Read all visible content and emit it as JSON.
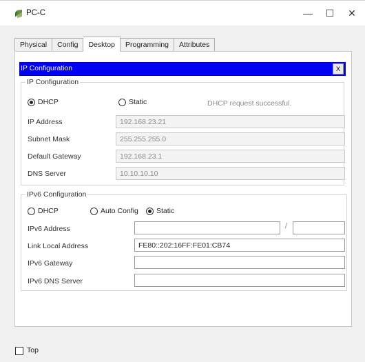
{
  "window": {
    "title": "PC-C",
    "minimize": "—",
    "maximize": "☐",
    "close": "✕"
  },
  "tabs": [
    {
      "label": "Physical",
      "active": false
    },
    {
      "label": "Config",
      "active": false
    },
    {
      "label": "Desktop",
      "active": true
    },
    {
      "label": "Programming",
      "active": false
    },
    {
      "label": "Attributes",
      "active": false
    }
  ],
  "dialog": {
    "title": "IP Configuration",
    "close_label": "X"
  },
  "ipv4": {
    "group_label": "IP Configuration",
    "dhcp_label": "DHCP",
    "static_label": "Static",
    "mode": "DHCP",
    "status": "DHCP request successful.",
    "fields": [
      {
        "label": "IP Address",
        "value": "192.168.23.21"
      },
      {
        "label": "Subnet Mask",
        "value": "255.255.255.0"
      },
      {
        "label": "Default Gateway",
        "value": "192.168.23.1"
      },
      {
        "label": "DNS Server",
        "value": "10.10.10.10"
      }
    ]
  },
  "ipv6": {
    "group_label": "IPv6 Configuration",
    "dhcp_label": "DHCP",
    "auto_label": "Auto Config",
    "static_label": "Static",
    "mode": "Static",
    "address_label": "IPv6 Address",
    "address_value": "",
    "prefix_value": "",
    "prefix_separator": "/",
    "link_local_label": "Link Local Address",
    "link_local_value": "FE80::202:16FF:FE01:CB74",
    "gateway_label": "IPv6 Gateway",
    "gateway_value": "",
    "dns_label": "IPv6 DNS Server",
    "dns_value": ""
  },
  "footer": {
    "top_label": "Top",
    "top_checked": false
  },
  "colors": {
    "dialog_bar": "#0000f5",
    "panel_bg": "#ffffff",
    "window_bg": "#f0f0f0"
  }
}
